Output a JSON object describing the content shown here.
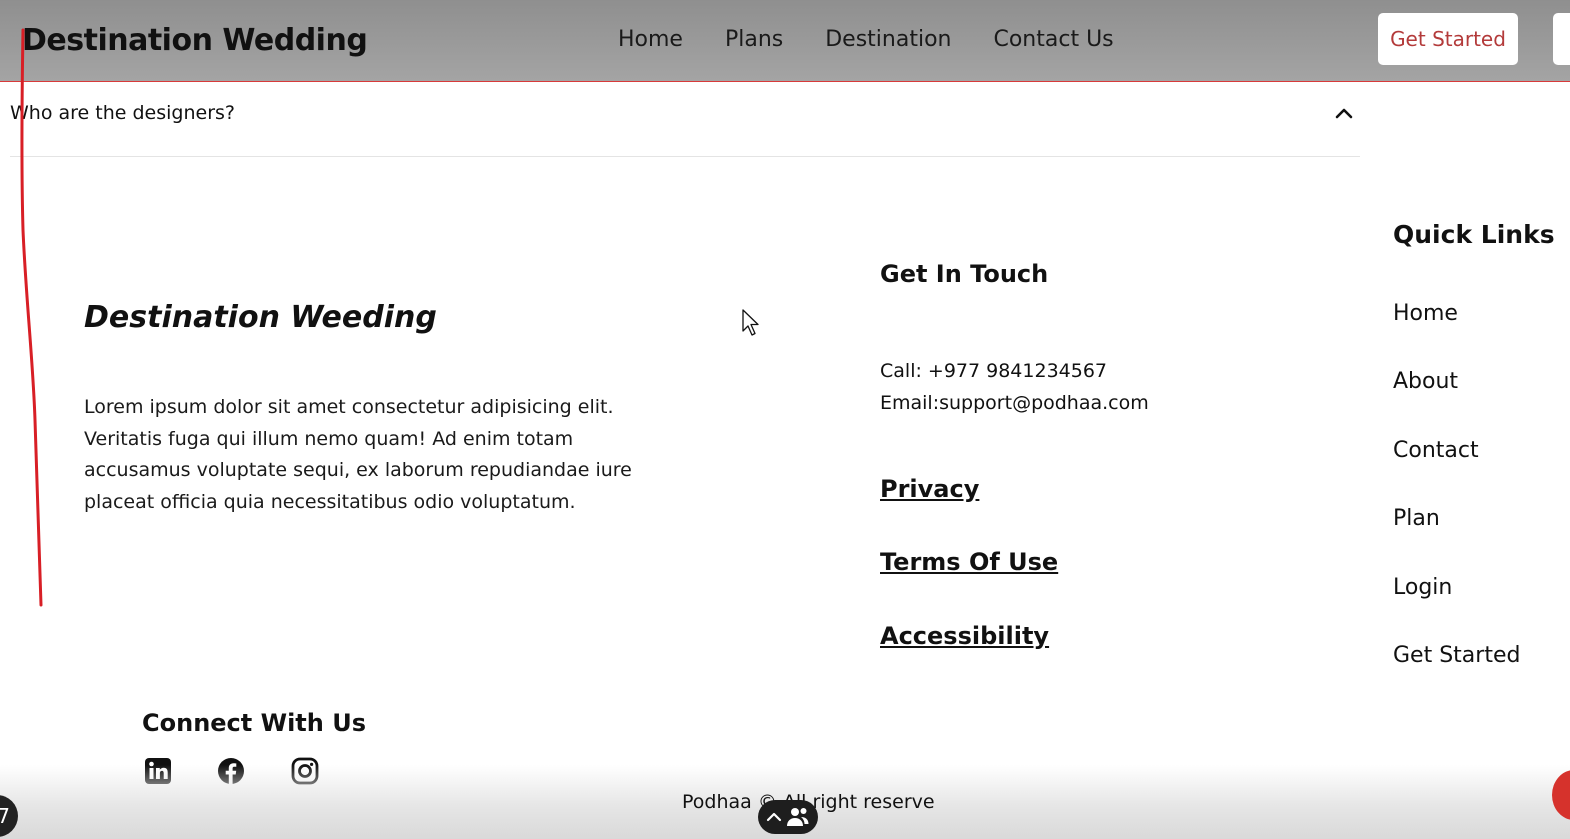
{
  "header": {
    "brand": "Destination Wedding",
    "nav": [
      "Home",
      "Plans",
      "Destination",
      "Contact Us"
    ],
    "cta_label": "Get Started"
  },
  "faq": {
    "question": "Who are the designers?"
  },
  "footer": {
    "brand": "Destination Weeding",
    "description": "Lorem ipsum dolor sit amet consectetur adipisicing elit. Veritatis fuga qui illum nemo quam! Ad enim totam accusamus voluptate sequi, ex laborum repudiandae iure placeat officia quia necessitatibus odio voluptatum.",
    "touch_heading": "Get In Touch",
    "call": "Call: +977 9841234567",
    "email": "Email:support@podhaa.com",
    "policy_links": [
      "Privacy",
      "Terms Of Use",
      "Accessibility"
    ],
    "quick_links_heading": "Quick Links",
    "quick_links": [
      "Home",
      "About",
      "Contact",
      "Plan",
      "Login",
      "Get Started"
    ],
    "connect_heading": "Connect With Us",
    "social_icons": [
      "linkedin-icon",
      "facebook-icon",
      "instagram-icon"
    ],
    "copyright": "Podhaa © All right reserve",
    "left_badge": "7"
  },
  "colors": {
    "header_bg": "#9a9a9a",
    "header_border": "#d83a3a",
    "cta_text": "#b33a3a",
    "annotation": "#d81f26"
  }
}
